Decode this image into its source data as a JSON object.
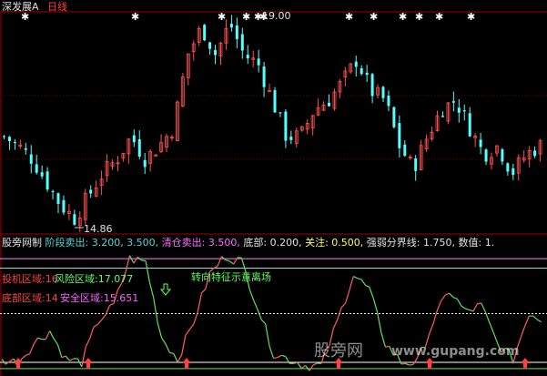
{
  "header": {
    "stock_name": "深发展A",
    "period": "日线",
    "high_label": "19.00",
    "low_label": "14.86"
  },
  "indicator_header": {
    "name": "股旁网制",
    "stage_sell": "阶段卖出: 3.200, 3.500,",
    "clear_sell": "清仓卖出: 3.500,",
    "bottom": "底部: 0.200,",
    "watch": "关注: 0.500,",
    "divider": "强弱分界线: 1.750,",
    "value": "数值: 1."
  },
  "zones": {
    "speculation": "投机区域:16",
    "risk": "风险区域:17.077",
    "bottom": "底部区域:14",
    "safe": "安全区域:15.651",
    "annotation": "转向特征示意离场"
  },
  "watermark": {
    "text": "股旁网",
    "url": "www.gupang.com"
  },
  "colors": {
    "up": "#ff5050",
    "down": "#54ffff",
    "bg": "#000000",
    "frame": "#a00000",
    "ind_up": "#ff6060",
    "ind_down": "#60e060"
  },
  "price_closes": [
    16.59,
    16.41,
    16.14,
    15.68,
    15.22,
    14.95,
    15.41,
    15.86,
    16.14,
    16.59,
    16.14,
    16.41,
    16.77,
    18.23,
    18.78,
    18.23,
    18.87,
    18.23,
    18.05,
    17.32,
    16.59,
    16.59,
    17.14,
    17.32,
    17.69,
    18.14,
    17.5,
    17.32,
    16.41,
    15.95,
    16.59,
    17.14,
    17.32,
    16.77,
    16.23,
    16.41,
    15.86,
    16.23,
    16.41
  ],
  "indicator_values": [
    0.3,
    0.2,
    0.8,
    1.2,
    0.3,
    0.2,
    1.5,
    2.0,
    3.5,
    3.4,
    1.0,
    0.3,
    1.5,
    3.0,
    3.6,
    3.4,
    2.0,
    0.5,
    0.3,
    0.1,
    0.1,
    1.5,
    3.0,
    2.5,
    0.8,
    0.2,
    0.2,
    1.5,
    2.5,
    1.8,
    2.0,
    0.8,
    0.3,
    1.8,
    1.5
  ]
}
